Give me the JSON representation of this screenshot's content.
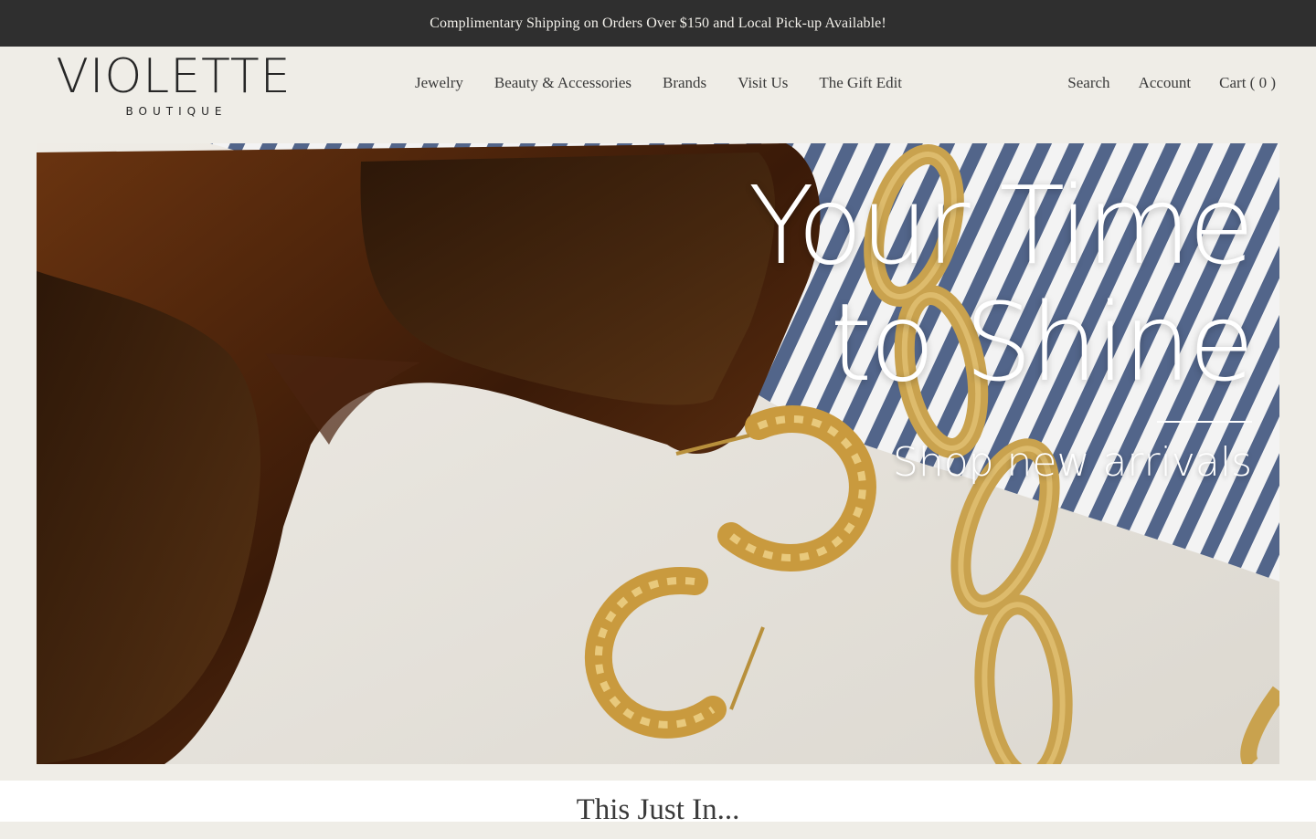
{
  "announcement": {
    "text": "Complimentary Shipping on Orders Over $150 and Local Pick-up Available!"
  },
  "brand": {
    "name": "VIOLETTE",
    "tagline": "BOUTIQUE"
  },
  "nav": {
    "items": [
      {
        "label": "Jewelry"
      },
      {
        "label": "Beauty & Accessories"
      },
      {
        "label": "Brands"
      },
      {
        "label": "Visit Us"
      },
      {
        "label": "The Gift Edit"
      }
    ]
  },
  "utility": {
    "search": "Search",
    "account": "Account",
    "cart": "Cart ( 0 )"
  },
  "hero": {
    "title_line1": "Your Time",
    "title_line2": "to Shine",
    "cta": "Shop new arrivals"
  },
  "section": {
    "title": "This Just In..."
  },
  "colors": {
    "announcement_bg": "#2f2f2f",
    "page_bg": "#efede7",
    "accent_gold": "#c9a24e"
  }
}
